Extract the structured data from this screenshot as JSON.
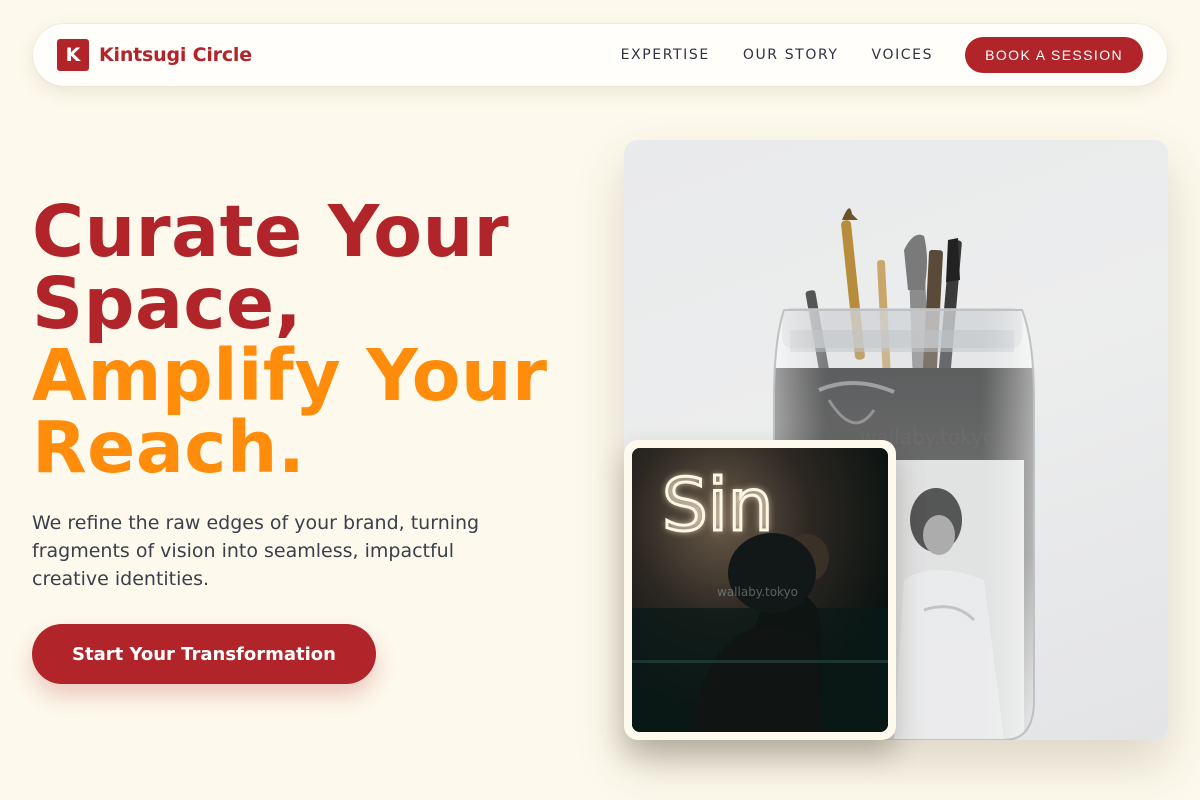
{
  "nav": {
    "brand_initial": "K",
    "brand_name": "Kintsugi Circle",
    "links": [
      "EXPERTISE",
      "OUR STORY",
      "VOICES"
    ],
    "cta": "BOOK A SESSION"
  },
  "hero": {
    "headline_line1": "Curate Your",
    "headline_line2": "Space,",
    "headline_line3": "Amplify Your",
    "headline_line4": "Reach.",
    "subtitle": "We refine the raw edges of your brand, turning fragments of vision into seamless, impactful creative identities.",
    "cta": "Start Your Transformation"
  },
  "images": {
    "main_watermark": "wallaby.tokyo",
    "inset_watermark": "wallaby.tokyo",
    "inset_neon_text": "Sin"
  },
  "colors": {
    "brand_red": "#b0242a",
    "accent_orange": "#ff8c0a",
    "background": "#fdf9ec",
    "body_text": "#3a3f4b"
  }
}
